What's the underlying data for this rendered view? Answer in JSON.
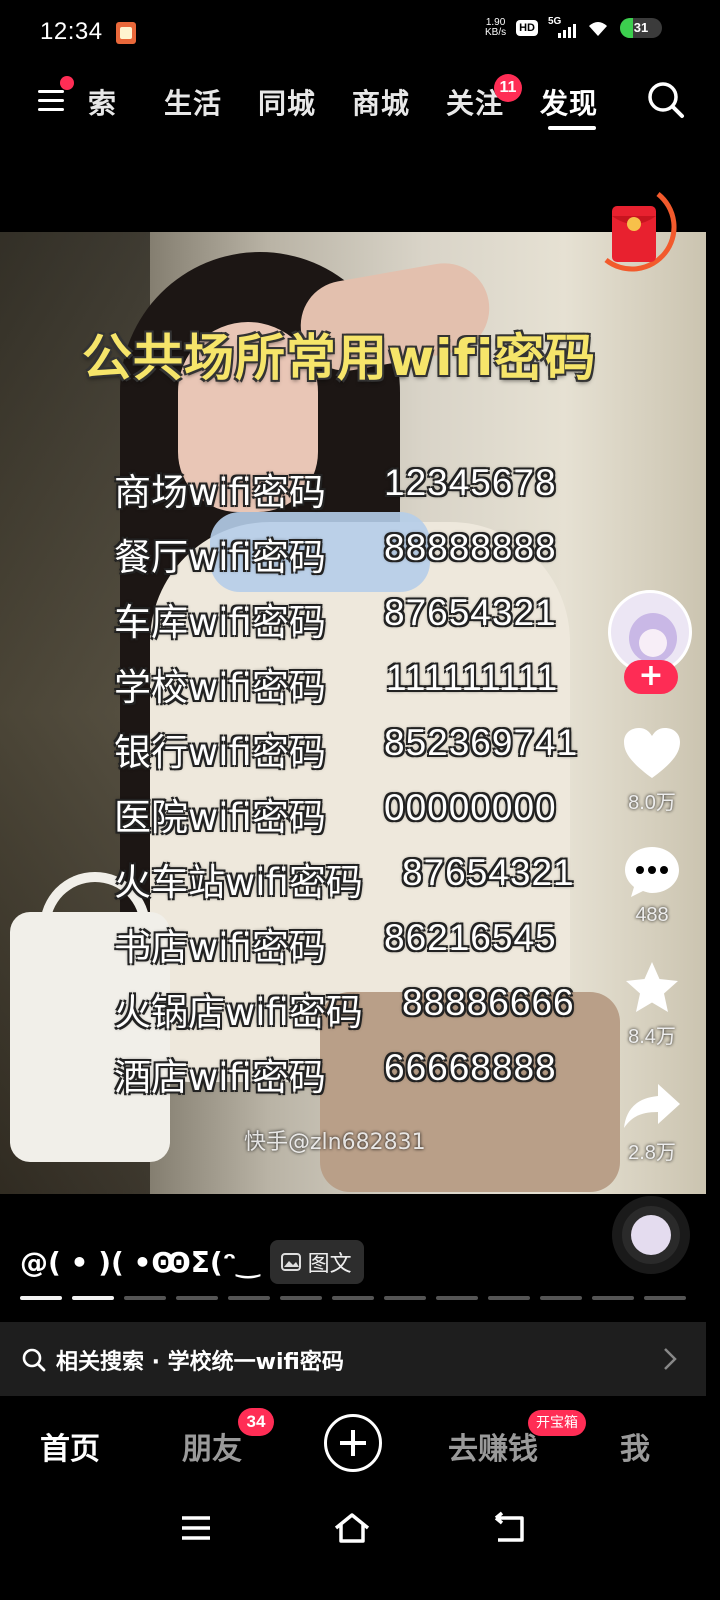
{
  "status_bar": {
    "time": "12:34",
    "net_speed_value": "1.90",
    "net_speed_unit": "KB/s",
    "hd": "HD",
    "network": "5G",
    "battery": "31",
    "battery_level": 0.31
  },
  "top_nav": {
    "tabs": [
      "搜索",
      "生活",
      "同城",
      "商城",
      "关注",
      "发现"
    ],
    "partial_first_tab": "索",
    "active_tab": "发现",
    "follow_badge": "11"
  },
  "post": {
    "image_title": "公共场所常用wifi密码",
    "passwords": [
      {
        "place": "商场wifi密码",
        "password": "12345678"
      },
      {
        "place": "餐厅wifi密码",
        "password": "88888888"
      },
      {
        "place": "车库wifi密码",
        "password": "87654321"
      },
      {
        "place": "学校wifi密码",
        "password": "111111111"
      },
      {
        "place": "银行wifi密码",
        "password": "852369741"
      },
      {
        "place": "医院wifi密码",
        "password": "00000000"
      },
      {
        "place": "火车站wifi密码",
        "password": "87654321"
      },
      {
        "place": "书店wifi密码",
        "password": "86216545"
      },
      {
        "place": "火锅店wifi密码",
        "password": "88886666"
      },
      {
        "place": "酒店wifi密码",
        "password": "66668888"
      }
    ],
    "watermark": "快手@zln682831"
  },
  "actions": {
    "follow": "+",
    "likes": "8.0万",
    "comments": "488",
    "favorites": "8.4万",
    "shares": "2.8万"
  },
  "caption": {
    "text": "@( • )( •ꙬΣ(ᵔ‿",
    "tag": "图文"
  },
  "progress": {
    "segments": 13,
    "watched": 2
  },
  "related_search": {
    "text": "相关搜索 · 学校统一wifi密码"
  },
  "bottom_tabs": {
    "home": "首页",
    "friends": "朋友",
    "friends_badge": "34",
    "earn": "去赚钱",
    "earn_badge": "开宝箱",
    "me": "我"
  },
  "colors": {
    "accent": "#ff2d55",
    "title_yellow": "#f6e56a",
    "battery_green": "#3ccf4e"
  }
}
